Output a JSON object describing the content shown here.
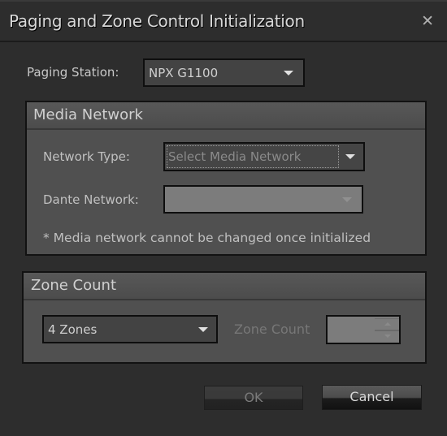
{
  "dialog": {
    "title": "Paging and Zone Control Initialization",
    "close_icon": "close-icon"
  },
  "paging_station": {
    "label": "Paging Station:",
    "selected": "NPX G1100"
  },
  "media_network": {
    "heading": "Media Network",
    "network_type_label": "Network Type:",
    "network_type_value": "Select Media Network",
    "dante_network_label": "Dante Network:",
    "dante_network_value": "",
    "note": "* Media network cannot be changed once initialized"
  },
  "zone_count": {
    "heading": "Zone Count",
    "selected": "4 Zones",
    "spinner_label": "Zone Count",
    "spinner_value": ""
  },
  "buttons": {
    "ok": "OK",
    "cancel": "Cancel"
  }
}
